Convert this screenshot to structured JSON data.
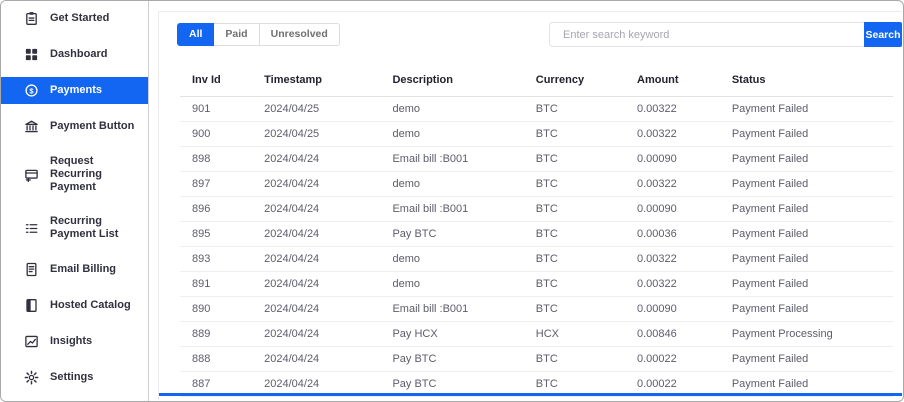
{
  "colors": {
    "primary": "#1266f1",
    "danger": "#f93154",
    "info": "#39c0ed"
  },
  "sidebar": {
    "items": [
      {
        "label": "Get Started",
        "icon": "clipboard-icon",
        "active": false
      },
      {
        "label": "Dashboard",
        "icon": "grid-icon",
        "active": false
      },
      {
        "label": "Payments",
        "icon": "dollar-circle-icon",
        "active": true
      },
      {
        "label": "Payment Button",
        "icon": "bank-icon",
        "active": false
      },
      {
        "label": "Request Recurring Payment",
        "icon": "card-plus-icon",
        "active": false
      },
      {
        "label": "Recurring Payment List",
        "icon": "list-icon",
        "active": false
      },
      {
        "label": "Email Billing",
        "icon": "file-text-icon",
        "active": false
      },
      {
        "label": "Hosted Catalog",
        "icon": "book-icon",
        "active": false
      },
      {
        "label": "Insights",
        "icon": "chart-icon",
        "active": false
      },
      {
        "label": "Settings",
        "icon": "gear-icon",
        "active": false
      }
    ]
  },
  "filters": {
    "tabs": [
      {
        "label": "All",
        "active": true
      },
      {
        "label": "Paid",
        "active": false
      },
      {
        "label": "Unresolved",
        "active": false
      }
    ]
  },
  "search": {
    "placeholder": "Enter search keyword",
    "value": "",
    "button_label": "Search"
  },
  "table": {
    "columns": [
      "Inv Id",
      "Timestamp",
      "Description",
      "Currency",
      "Amount",
      "Status"
    ],
    "rows": [
      {
        "inv_id": "901",
        "timestamp": "2024/04/25",
        "description": "demo",
        "currency": "BTC",
        "amount": "0.00322",
        "status": "Payment Failed",
        "status_type": "failed"
      },
      {
        "inv_id": "900",
        "timestamp": "2024/04/25",
        "description": "demo",
        "currency": "BTC",
        "amount": "0.00322",
        "status": "Payment Failed",
        "status_type": "failed"
      },
      {
        "inv_id": "898",
        "timestamp": "2024/04/24",
        "description": "Email bill :B001",
        "currency": "BTC",
        "amount": "0.00090",
        "status": "Payment Failed",
        "status_type": "failed"
      },
      {
        "inv_id": "897",
        "timestamp": "2024/04/24",
        "description": "demo",
        "currency": "BTC",
        "amount": "0.00322",
        "status": "Payment Failed",
        "status_type": "failed"
      },
      {
        "inv_id": "896",
        "timestamp": "2024/04/24",
        "description": "Email bill :B001",
        "currency": "BTC",
        "amount": "0.00090",
        "status": "Payment Failed",
        "status_type": "failed"
      },
      {
        "inv_id": "895",
        "timestamp": "2024/04/24",
        "description": "Pay BTC",
        "currency": "BTC",
        "amount": "0.00036",
        "status": "Payment Failed",
        "status_type": "failed"
      },
      {
        "inv_id": "893",
        "timestamp": "2024/04/24",
        "description": "demo",
        "currency": "BTC",
        "amount": "0.00322",
        "status": "Payment Failed",
        "status_type": "failed"
      },
      {
        "inv_id": "891",
        "timestamp": "2024/04/24",
        "description": "demo",
        "currency": "BTC",
        "amount": "0.00322",
        "status": "Payment Failed",
        "status_type": "failed"
      },
      {
        "inv_id": "890",
        "timestamp": "2024/04/24",
        "description": "Email bill :B001",
        "currency": "BTC",
        "amount": "0.00090",
        "status": "Payment Failed",
        "status_type": "failed"
      },
      {
        "inv_id": "889",
        "timestamp": "2024/04/24",
        "description": "Pay HCX",
        "currency": "HCX",
        "amount": "0.00846",
        "status": "Payment Processing",
        "status_type": "processing"
      },
      {
        "inv_id": "888",
        "timestamp": "2024/04/24",
        "description": "Pay BTC",
        "currency": "BTC",
        "amount": "0.00022",
        "status": "Payment Failed",
        "status_type": "failed"
      },
      {
        "inv_id": "887",
        "timestamp": "2024/04/24",
        "description": "Pay BTC",
        "currency": "BTC",
        "amount": "0.00022",
        "status": "Payment Failed",
        "status_type": "failed"
      }
    ]
  }
}
